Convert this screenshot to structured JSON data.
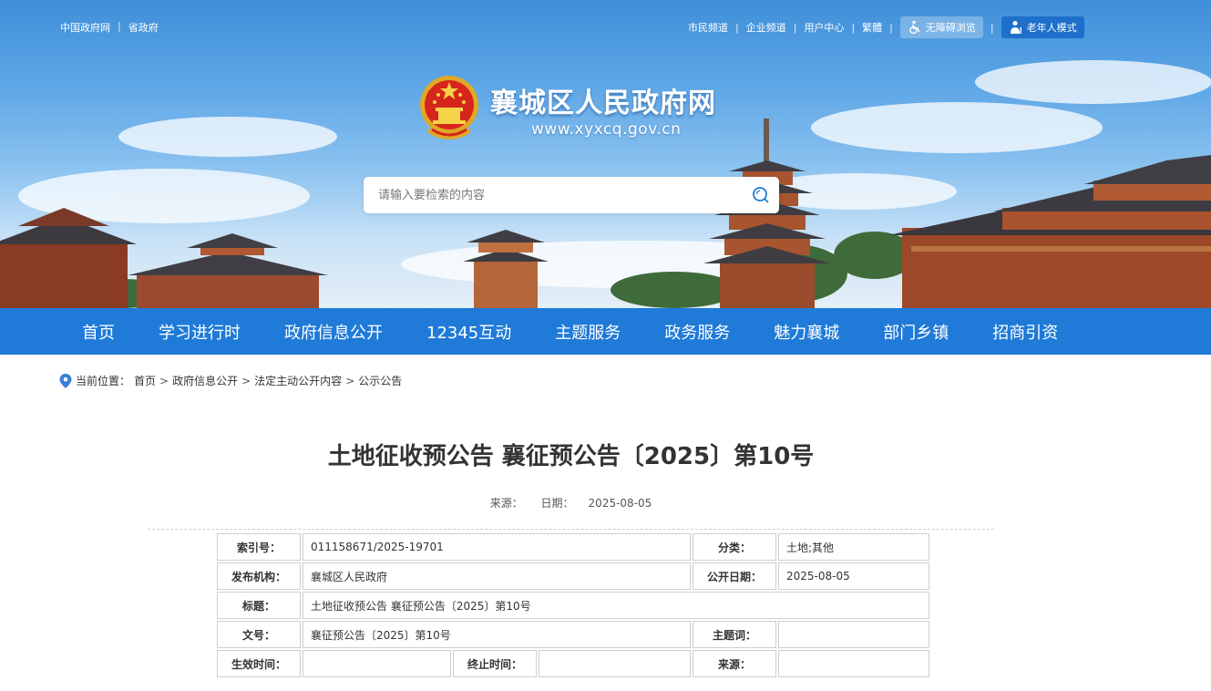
{
  "top_left_links": [
    "中国政府网",
    "省政府"
  ],
  "top_right_links": [
    "市民频道",
    "企业频道",
    "用户中心",
    "繁體"
  ],
  "accessibility_label": "无障碍浏览",
  "elder_mode_label": "老年人模式",
  "site": {
    "title": "襄城区人民政府网",
    "url": "www.xyxcq.gov.cn"
  },
  "search": {
    "placeholder": "请输入要检索的内容",
    "icon": "search-icon"
  },
  "nav": [
    "首页",
    "学习进行时",
    "政府信息公开",
    "12345互动",
    "主题服务",
    "政务服务",
    "魅力襄城",
    "部门乡镇",
    "招商引资"
  ],
  "breadcrumb": {
    "label": "当前位置：",
    "items": [
      "首页",
      "政府信息公开",
      "法定主动公开内容",
      "公示公告"
    ],
    "separator": ">"
  },
  "article": {
    "title": "土地征收预公告 襄征预公告〔2025〕第10号",
    "source_label": "来源：",
    "date_label": "日期：",
    "date": "2025-08-05"
  },
  "info_table": {
    "index_label": "索引号：",
    "index_value": "011158671/2025-19701",
    "category_label": "分类：",
    "category_value": "土地;其他",
    "publisher_label": "发布机构：",
    "publisher_value": "襄城区人民政府",
    "pubdate_label": "公开日期：",
    "pubdate_value": "2025-08-05",
    "title_label": "标题：",
    "title_value": "土地征收预公告 襄征预公告〔2025〕第10号",
    "docno_label": "文号：",
    "docno_value": "襄征预公告〔2025〕第10号",
    "keywords_label": "主题词：",
    "keywords_value": "",
    "effective_label": "生效时间：",
    "effective_value": "",
    "expire_label": "终止时间：",
    "expire_value": "",
    "source_label": "来源：",
    "source_value": ""
  },
  "colors": {
    "nav_bg": "#1f7ad8",
    "elder_btn": "#1d6fc9",
    "title": "#333333"
  }
}
